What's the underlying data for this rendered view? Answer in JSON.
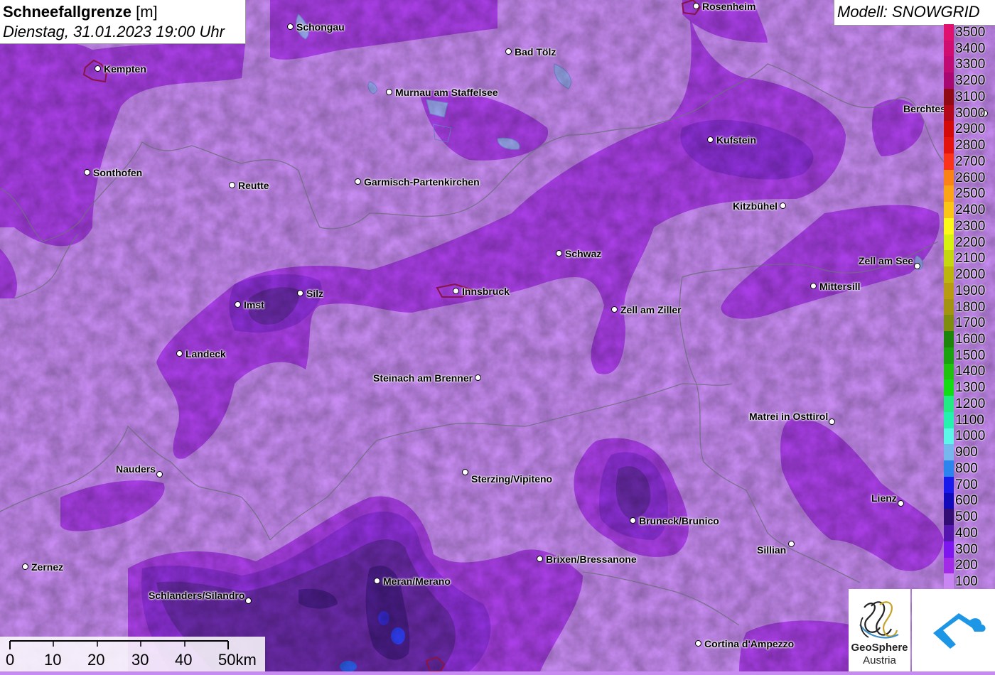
{
  "header": {
    "title": "Schneefallgrenze",
    "unit": "[m]",
    "subtitle": "Dienstag, 31.01.2023 19:00 Uhr"
  },
  "model": {
    "label": "Modell: SNOWGRID"
  },
  "legend": [
    {
      "label": "3500",
      "color": "#e0116e"
    },
    {
      "label": "3400",
      "color": "#d00e72"
    },
    {
      "label": "3300",
      "color": "#c00b74"
    },
    {
      "label": "3200",
      "color": "#a70872"
    },
    {
      "label": "3100",
      "color": "#8f0a13"
    },
    {
      "label": "3000",
      "color": "#b3081a"
    },
    {
      "label": "2900",
      "color": "#d20a0a"
    },
    {
      "label": "2800",
      "color": "#e3140e"
    },
    {
      "label": "2700",
      "color": "#f9341b"
    },
    {
      "label": "2600",
      "color": "#fb8214"
    },
    {
      "label": "2500",
      "color": "#fba516"
    },
    {
      "label": "2400",
      "color": "#fbc515"
    },
    {
      "label": "2300",
      "color": "#fcfa17"
    },
    {
      "label": "2200",
      "color": "#d8f20f"
    },
    {
      "label": "2100",
      "color": "#c4d70f"
    },
    {
      "label": "2000",
      "color": "#bcb50c"
    },
    {
      "label": "1900",
      "color": "#b89b10"
    },
    {
      "label": "1800",
      "color": "#a39311"
    },
    {
      "label": "1700",
      "color": "#7f8d0f"
    },
    {
      "label": "1600",
      "color": "#1c840b"
    },
    {
      "label": "1500",
      "color": "#19a10f"
    },
    {
      "label": "1400",
      "color": "#20c10f"
    },
    {
      "label": "1300",
      "color": "#14dc14"
    },
    {
      "label": "1200",
      "color": "#22eb83"
    },
    {
      "label": "1100",
      "color": "#24f2ae"
    },
    {
      "label": "1000",
      "color": "#5cf7e8"
    },
    {
      "label": "900",
      "color": "#76b8ee"
    },
    {
      "label": "800",
      "color": "#2c85ee"
    },
    {
      "label": "700",
      "color": "#1919ec"
    },
    {
      "label": "600",
      "color": "#120ab9"
    },
    {
      "label": "500",
      "color": "#310d74"
    },
    {
      "label": "400",
      "color": "#5416ac"
    },
    {
      "label": "300",
      "color": "#7e17ee"
    },
    {
      "label": "200",
      "color": "#a32be8"
    },
    {
      "label": "100",
      "color": "#c985f2"
    }
  ],
  "cities": [
    {
      "name": "Rosenheim",
      "dot": [
        980,
        9
      ],
      "label": "right"
    },
    {
      "name": "Schongau",
      "dot": [
        409,
        38
      ],
      "label": "right"
    },
    {
      "name": "Bad Tölz",
      "dot": [
        716,
        73
      ],
      "label": "right"
    },
    {
      "name": "Kempten",
      "dot": [
        138,
        97
      ],
      "label": "right"
    },
    {
      "name": "Murnau am Staffelsee",
      "dot": [
        548,
        130
      ],
      "label": "right"
    },
    {
      "name": "Berchtesgaden",
      "dot": [
        1386,
        160
      ],
      "label": "left-clip",
      "shown": "Berchtes"
    },
    {
      "name": "Kufstein",
      "dot": [
        1000,
        197
      ],
      "label": "right"
    },
    {
      "name": "Sonthofen",
      "dot": [
        123,
        243
      ],
      "label": "right"
    },
    {
      "name": "Reutte",
      "dot": [
        327,
        261
      ],
      "label": "right"
    },
    {
      "name": "Garmisch-Partenkirchen",
      "dot": [
        504,
        256
      ],
      "label": "right"
    },
    {
      "name": "Kitzbühel",
      "dot": [
        1102,
        290
      ],
      "label": "left"
    },
    {
      "name": "Schwaz",
      "dot": [
        787,
        357
      ],
      "label": "right"
    },
    {
      "name": "Zell am See",
      "dot": [
        1291,
        375
      ],
      "label": "left-up"
    },
    {
      "name": "Mittersill",
      "dot": [
        1145,
        403
      ],
      "label": "right"
    },
    {
      "name": "Innsbruck",
      "dot": [
        642,
        410
      ],
      "label": "right"
    },
    {
      "name": "Silz",
      "dot": [
        423,
        413
      ],
      "label": "right"
    },
    {
      "name": "Imst",
      "dot": [
        335,
        429
      ],
      "label": "right"
    },
    {
      "name": "Zell am Ziller",
      "dot": [
        865,
        436
      ],
      "label": "right"
    },
    {
      "name": "Landeck",
      "dot": [
        253,
        498
      ],
      "label": "right"
    },
    {
      "name": "Steinach am Brenner",
      "dot": [
        673,
        532
      ],
      "label": "left"
    },
    {
      "name": "Matrei in Osttirol",
      "dot": [
        1171,
        594
      ],
      "label": "left-up"
    },
    {
      "name": "Nauders",
      "dot": [
        225,
        668
      ],
      "label": "left-up"
    },
    {
      "name": "Sterzing/Vipiteno",
      "dot": [
        655,
        665
      ],
      "label": "right-down"
    },
    {
      "name": "Lienz",
      "dot": [
        1268,
        709
      ],
      "label": "left-up"
    },
    {
      "name": "Bruneck/Brunico",
      "dot": [
        891,
        733
      ],
      "label": "right"
    },
    {
      "name": "Sillian",
      "dot": [
        1114,
        766
      ],
      "label": "left-down"
    },
    {
      "name": "Brixen/Bressanone",
      "dot": [
        760,
        787
      ],
      "label": "right"
    },
    {
      "name": "Zernez",
      "dot": [
        36,
        798
      ],
      "label": "right"
    },
    {
      "name": "Meran/Merano",
      "dot": [
        531,
        818
      ],
      "label": "right"
    },
    {
      "name": "Schlanders/Silandro",
      "dot": [
        350,
        846
      ],
      "label": "left-up"
    },
    {
      "name": "Cortina d'Ampezzo",
      "dot": [
        983,
        906
      ],
      "label": "right"
    }
  ],
  "scale_bar": {
    "labels": [
      "0",
      "10",
      "20",
      "30",
      "40",
      "50km"
    ]
  },
  "logos": {
    "geosphere_line1": "GeoSphere",
    "geosphere_line2": "Austria"
  }
}
